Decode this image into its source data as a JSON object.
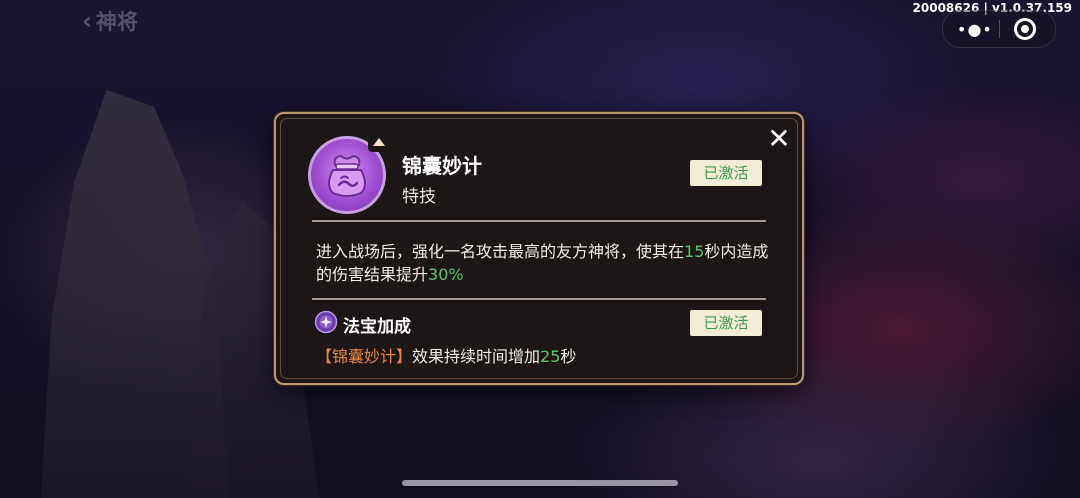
{
  "topbar": {
    "back_icon": "chevron-left-icon",
    "title": "神将",
    "version": "20008626 | v1.0.37.159",
    "more_icon": "more-dots-icon",
    "target_icon": "target-close-icon"
  },
  "dialog": {
    "close_icon": "close-x-icon",
    "skill_icon": "lucky-bag-icon",
    "skill_name": "锦囊妙计",
    "skill_type": "特技",
    "status_label": "已激活",
    "description": {
      "part1": "进入战场后，强化一名攻击最高的友方神将，使其在",
      "duration": "15",
      "part2": "秒内造成的伤害结果提升",
      "percent": "30%"
    },
    "bonus": {
      "icon": "treasure-orb-icon",
      "title": "法宝加成",
      "status_label": "已激活",
      "skill_ref": "【锦囊妙计】",
      "text": "效果持续时间增加",
      "extra": "25",
      "unit": "秒"
    }
  },
  "colors": {
    "accent_green": "#5cc46a",
    "accent_orange": "#e9883a",
    "dialog_border": "#b89a72",
    "badge_bg": "#f3ecd6"
  }
}
